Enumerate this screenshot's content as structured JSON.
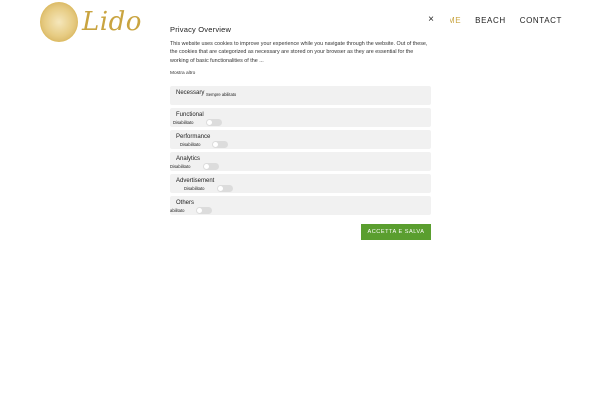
{
  "header": {
    "logo_text": "Lido Ne",
    "nav": [
      "HOME",
      "BEACH",
      "CONTACT"
    ],
    "accent_color": "#c9a440"
  },
  "modal": {
    "title": "Privacy Overview",
    "close_label": "×",
    "description": "This website uses cookies to improve your experience while you navigate through the website. Out of these, the cookies that are categorized as necessary are stored on your browser as they are essential for the working of basic functionalities of the ...",
    "show_more": "Mostra altro",
    "categories": [
      {
        "name": "Necessary",
        "status": "Sempre abilitato"
      },
      {
        "name": "Functional",
        "status": "Disabilitato"
      },
      {
        "name": "Performance",
        "status": "Disabilitato"
      },
      {
        "name": "Analytics",
        "status": "Disabilitato"
      },
      {
        "name": "Advertisement",
        "status": "Disabilitato"
      },
      {
        "name": "Others",
        "status": "abilitato"
      }
    ],
    "accept_label": "ACCETTA E SALVA",
    "accept_color": "#5a9e2f"
  }
}
